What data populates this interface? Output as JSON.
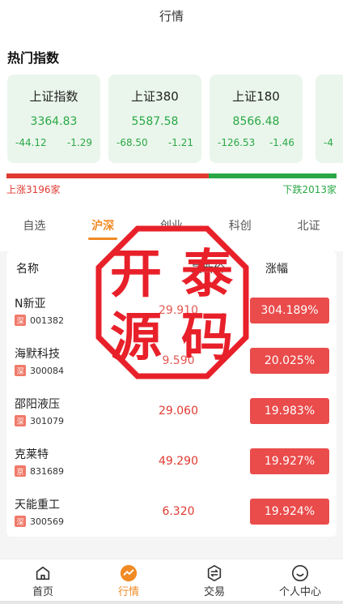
{
  "header": {
    "title": "行情"
  },
  "hot": {
    "title": "热门指数",
    "cards": [
      {
        "name": "上证指数",
        "value": "3364.83",
        "change": "-44.12",
        "percent": "-1.29"
      },
      {
        "name": "上证380",
        "value": "5587.58",
        "change": "-68.50",
        "percent": "-1.21"
      },
      {
        "name": "上证180",
        "value": "8566.48",
        "change": "-126.53",
        "percent": "-1.46"
      },
      {
        "name": "",
        "value": "",
        "change": "-4",
        "percent": ""
      }
    ],
    "breadth": {
      "up_label": "上涨3196家",
      "down_label": "下跌2013家",
      "up_count": 3196,
      "down_count": 2013
    }
  },
  "tabs": [
    {
      "label": "自选"
    },
    {
      "label": "沪深"
    },
    {
      "label": "创业"
    },
    {
      "label": "科创"
    },
    {
      "label": "北证"
    }
  ],
  "active_tab": 1,
  "table": {
    "headers": {
      "name": "名称",
      "price": "最新价",
      "pct": "涨幅"
    },
    "rows": [
      {
        "name": "N新亚",
        "market": "深",
        "code": "001382",
        "price": "29.910",
        "pct": "304.189%"
      },
      {
        "name": "海默科技",
        "market": "深",
        "code": "300084",
        "price": "9.590",
        "pct": "20.025%"
      },
      {
        "name": "邵阳液压",
        "market": "深",
        "code": "301079",
        "price": "29.060",
        "pct": "19.983%"
      },
      {
        "name": "克莱特",
        "market": "京",
        "code": "831689",
        "price": "49.290",
        "pct": "19.927%"
      },
      {
        "name": "天能重工",
        "market": "深",
        "code": "300569",
        "price": "6.320",
        "pct": "19.924%"
      }
    ]
  },
  "stamp": {
    "chars": [
      "开",
      "泰",
      "源",
      "码"
    ],
    "color": "#e8202a"
  },
  "nav": [
    {
      "label": "首页",
      "icon": "home-icon"
    },
    {
      "label": "行情",
      "icon": "chart-icon"
    },
    {
      "label": "交易",
      "icon": "exchange-icon"
    },
    {
      "label": "个人中心",
      "icon": "profile-icon"
    }
  ],
  "colors": {
    "accent": "#f08a24",
    "up": "#e03a32",
    "down": "#2aa845",
    "card_bg": "#eaf6ec"
  }
}
